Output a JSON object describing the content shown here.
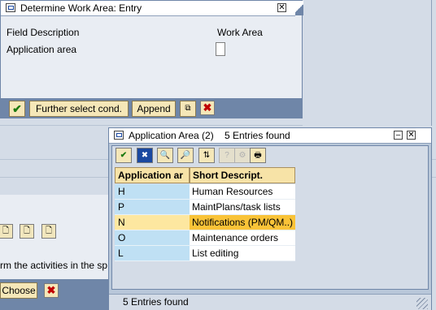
{
  "background": {
    "hint_text": "rm the activities in the sp",
    "choose_label": "Choose",
    "cancel_glyph": "✖"
  },
  "dialog1": {
    "title": "Determine Work Area: Entry",
    "close_glyph": "✕",
    "field_description_header": "Field Description",
    "work_area_header": "Work Area",
    "application_area_label": "Application area",
    "application_area_value": "",
    "toolbar": {
      "confirm_glyph": "✔",
      "further_select_label": "Further select cond.",
      "append_label": "Append",
      "cancel_glyph": "✖"
    }
  },
  "dialog2": {
    "title": "Application Area (2)",
    "entries_found_title": "5 Entries found",
    "minimize_glyph": "–",
    "close_glyph": "✕",
    "toolbar": {
      "confirm_glyph": "✔",
      "cancel_glyph": "✖"
    },
    "table": {
      "headers": [
        "Application ar",
        "Short Descript."
      ],
      "rows": [
        {
          "code": "H",
          "text": "Human Resources"
        },
        {
          "code": "P",
          "text": "MaintPlans/task lists"
        },
        {
          "code": "N",
          "text": "Notifications (PM/QM..)"
        },
        {
          "code": "O",
          "text": "Maintenance orders"
        },
        {
          "code": "L",
          "text": "List editing"
        }
      ],
      "selected_row": 2
    },
    "status_text": "5 Entries found"
  }
}
